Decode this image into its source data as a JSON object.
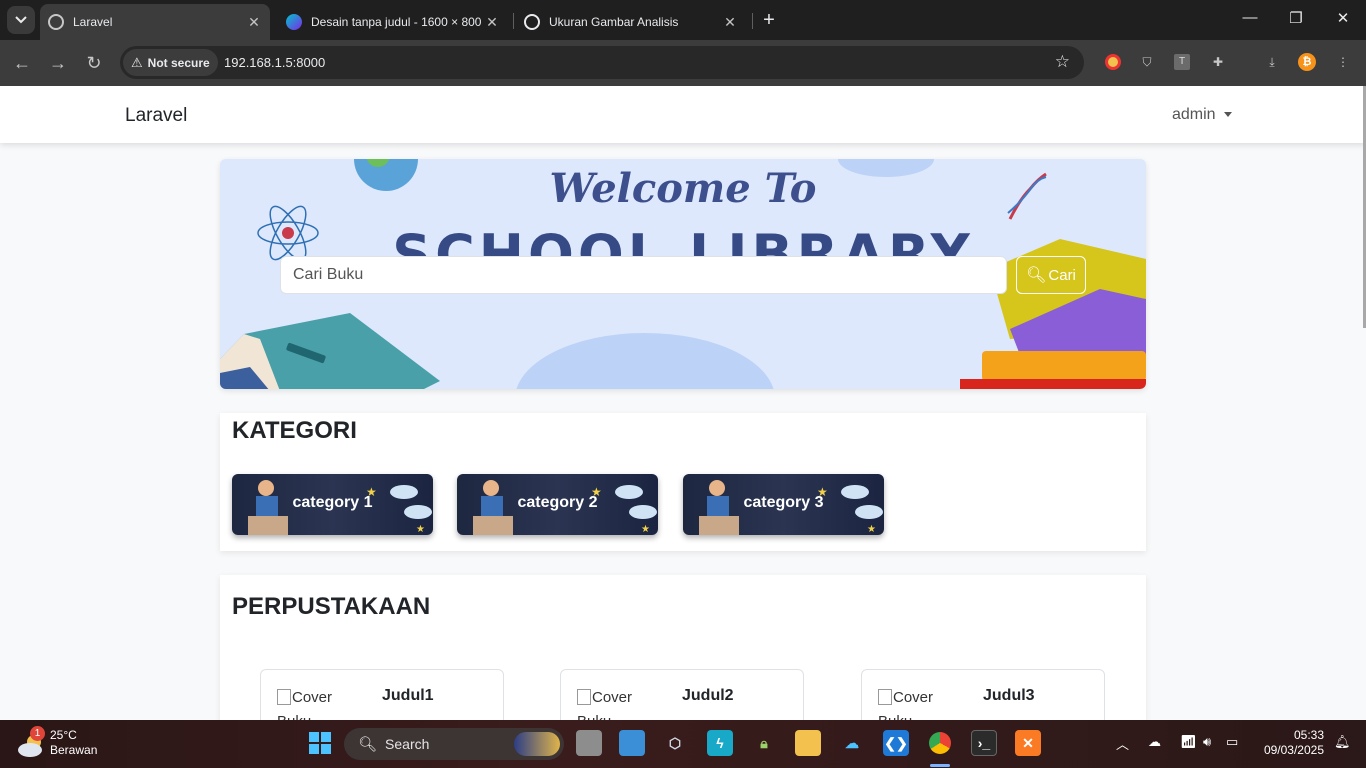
{
  "browser": {
    "tabs": [
      {
        "title": "Laravel",
        "active": true
      },
      {
        "title": "Desain tanpa judul - 1600 × 800",
        "active": false
      },
      {
        "title": "Ukuran Gambar Analisis",
        "active": false
      }
    ],
    "security_label": "Not secure",
    "url": "192.168.1.5:8000"
  },
  "navbar": {
    "brand": "Laravel",
    "user": "admin"
  },
  "hero": {
    "welcome": "Welcome To",
    "library": "SCHOOL LIBRARY",
    "search_placeholder": "Cari Buku",
    "search_button": "Cari"
  },
  "kategori": {
    "title": "KATEGORI",
    "items": [
      {
        "label": "category 1"
      },
      {
        "label": "category 2"
      },
      {
        "label": "category 3"
      }
    ]
  },
  "perpustakaan": {
    "title": "PERPUSTAKAAN",
    "books": [
      {
        "cover_alt": "Cover Buku",
        "title": "Judul1"
      },
      {
        "cover_alt": "Cover Buku",
        "title": "Judul2"
      },
      {
        "cover_alt": "Cover Buku",
        "title": "Judul3"
      }
    ]
  },
  "taskbar": {
    "weather_temp": "25°C",
    "weather_desc": "Berawan",
    "weather_badge": "1",
    "search_label": "Search",
    "time": "05:33",
    "date": "09/03/2025"
  },
  "colors": {
    "hero_bg": "#dde8fc",
    "hero_text": "#3d4f8c",
    "chrome_dark": "#1f1f1f",
    "category_bg": "#2b3552"
  }
}
